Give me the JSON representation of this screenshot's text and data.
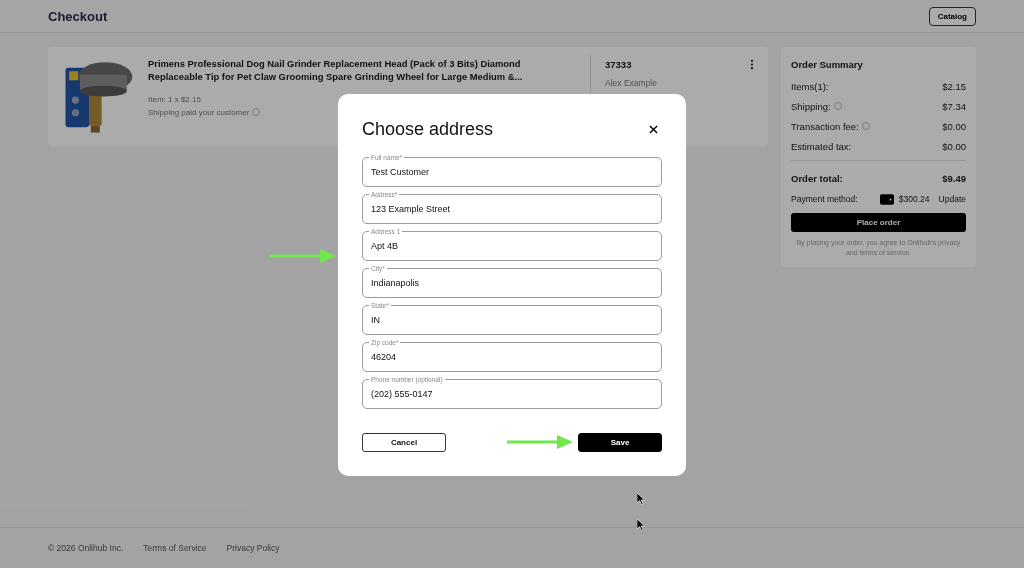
{
  "header": {
    "title": "Checkout",
    "catalog_button": "Catalog"
  },
  "order_item": {
    "title": "Primens Professional Dog Nail Grinder Replacement Head (Pack of 3 Bits) Diamond Replaceable Tip for Pet Claw Grooming Spare Grinding Wheel for Large Medium &...",
    "quantity": "Item: 1 x $2.15",
    "shipping_note": "Shipping paid your customer",
    "order_number": "37333",
    "recipient": "Alex Example"
  },
  "order_summary": {
    "title": "Order Summary",
    "lines": [
      {
        "label": "Items(1):",
        "value": "$2.15",
        "info": false
      },
      {
        "label": "Shipping:",
        "value": "$7.34",
        "info": true
      },
      {
        "label": "Transaction fee:",
        "value": "$0.00",
        "info": true
      },
      {
        "label": "Estimated tax:",
        "value": "$0.00",
        "info": false
      }
    ],
    "total_label": "Order total:",
    "total_value": "$9.49",
    "payment_label": "Payment method:",
    "payment_balance": "$300.24",
    "update_link": "Update",
    "place_order_button": "Place order",
    "disclaimer": "By placing your order, you agree to Onlihub's privacy and terms of service."
  },
  "modal": {
    "title": "Choose address",
    "fields": [
      {
        "label": "Full name*",
        "value": "Test Customer"
      },
      {
        "label": "Address*",
        "value": "123 Example Street"
      },
      {
        "label": "Address 1",
        "value": "Apt 4B"
      },
      {
        "label": "City*",
        "value": "Indianapolis"
      },
      {
        "label": "State*",
        "value": "IN"
      },
      {
        "label": "Zip code*",
        "value": "46204"
      },
      {
        "label": "Phone number (optional)",
        "value": "(202) 555-0147"
      }
    ],
    "cancel_button": "Cancel",
    "save_button": "Save"
  },
  "footer": {
    "copyright": "© 2026 Onlihub Inc.",
    "links": [
      "Terms of Service",
      "Privacy Policy"
    ]
  }
}
